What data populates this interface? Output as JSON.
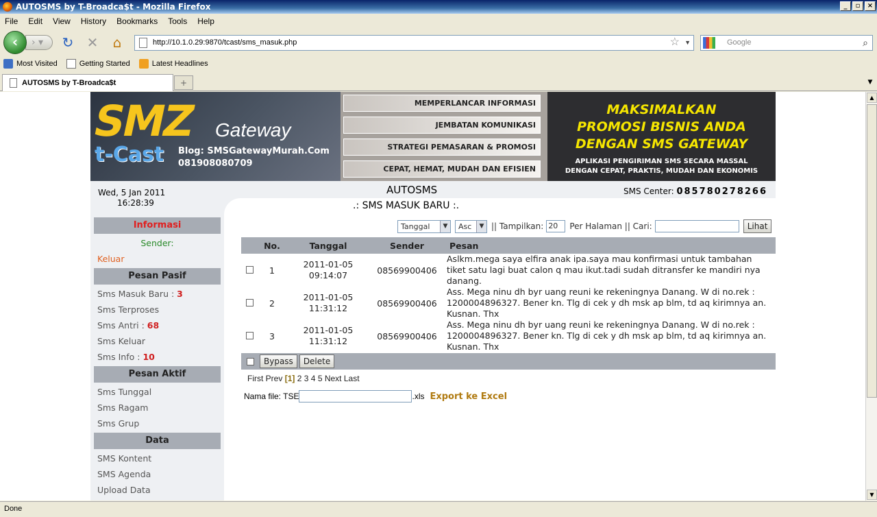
{
  "window": {
    "title": "AUTOSMS by T-Broadca$t - Mozilla Firefox"
  },
  "menu": [
    "File",
    "Edit",
    "View",
    "History",
    "Bookmarks",
    "Tools",
    "Help"
  ],
  "nav": {
    "url": "http://10.1.0.29:9870/tcast/sms_masuk.php",
    "search_placeholder": "Google"
  },
  "bookmarks": [
    "Most Visited",
    "Getting Started",
    "Latest Headlines"
  ],
  "tab": {
    "title": "AUTOSMS by T-Broadca$t"
  },
  "status": "Done",
  "banner": {
    "brand": "SMZ",
    "gateway": "Gateway",
    "tcast": "t-Cast",
    "blog": "Blog: SMSGatewayMurah.Com",
    "phone": "081908080709",
    "strips": [
      "MEMPERLANCAR INFORMASI",
      "JEMBATAN KOMUNIKASI",
      "STRATEGI PEMASARAN & PROMOSI",
      "CEPAT, HEMAT, MUDAH DAN EFISIEN"
    ],
    "promo_big": [
      "MAKSIMALKAN",
      "PROMOSI BISNIS ANDA",
      "DENGAN SMS GATEWAY"
    ],
    "promo_small": [
      "APLIKASI PENGIRIMAN SMS SECARA MASSAL",
      "DENGAN CEPAT, PRAKTIS, MUDAH DAN EKONOMIS"
    ]
  },
  "header": {
    "date": "Wed, 5 Jan 2011",
    "time": "16:28:39",
    "app_title": "AUTOSMS",
    "sms_center_label": "SMS Center:",
    "sms_center_number": "085780278266"
  },
  "sidebar": {
    "informasi": "Informasi",
    "sender_label": "Sender:",
    "logout": "Keluar",
    "pasif_head": "Pesan Pasif",
    "pasif_items": [
      {
        "label": "Sms Masuk Baru",
        "count": "3"
      },
      {
        "label": "Sms Terproses",
        "count": ""
      },
      {
        "label": "Sms Antri",
        "count": "68"
      },
      {
        "label": "Sms Keluar",
        "count": ""
      },
      {
        "label": "Sms Info",
        "count": "10"
      }
    ],
    "aktif_head": "Pesan Aktif",
    "aktif_items": [
      "Sms Tunggal",
      "Sms Ragam",
      "Sms Grup"
    ],
    "data_head": "Data",
    "data_items": [
      "SMS Kontent",
      "SMS Agenda",
      "Upload Data"
    ]
  },
  "main": {
    "subtitle": ".: SMS MASUK BARU :.",
    "sort_field": "Tanggal",
    "sort_order": "Asc",
    "tampilkan_label": "|| Tampilkan:",
    "per_page": "20",
    "per_halaman_label": "Per Halaman || Cari:",
    "search_value": "",
    "lihat": "Lihat"
  },
  "table": {
    "headers": [
      "No.",
      "Tanggal",
      "Sender",
      "Pesan"
    ],
    "rows": [
      {
        "no": "1",
        "date": "2011-01-05",
        "time": "09:14:07",
        "sender": "08569900406",
        "pesan": "Aslkm.mega saya elfira anak ipa.saya mau konfirmasi untuk tambahan tiket satu lagi buat calon q mau ikut.tadi sudah ditransfer ke mandiri nya danang."
      },
      {
        "no": "2",
        "date": "2011-01-05",
        "time": "11:31:12",
        "sender": "08569900406",
        "pesan": "Ass. Mega ninu dh byr uang reuni ke rekeningnya Danang. W di no.rek : 1200004896327. Bener kn. Tlg di cek y dh msk ap blm, td aq kirimnya an. Kusnan. Thx"
      },
      {
        "no": "3",
        "date": "2011-01-05",
        "time": "11:31:12",
        "sender": "08569900406",
        "pesan": "Ass. Mega ninu dh byr uang reuni ke rekeningnya Danang. W di no.rek : 1200004896327. Bener kn. Tlg di cek y dh msk ap blm, td aq kirimnya an. Kusnan. Thx"
      }
    ],
    "bypass": "Bypass",
    "delete": "Delete"
  },
  "pager": {
    "first": "First",
    "prev": "Prev",
    "current": "[1]",
    "pages": [
      "2",
      "3",
      "4",
      "5"
    ],
    "next": "Next",
    "last": "Last"
  },
  "export": {
    "label": "Nama file: TSE",
    "value": "",
    "ext": ".xls",
    "button": "Export ke Excel"
  }
}
